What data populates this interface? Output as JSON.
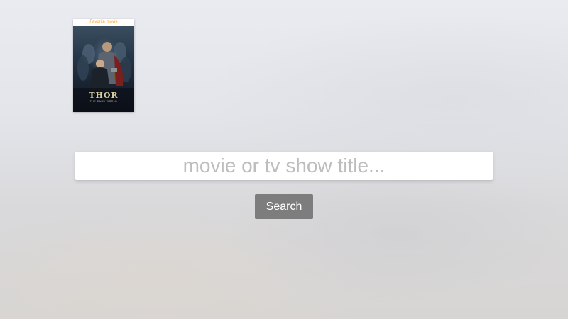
{
  "favorites": {
    "label": "Favorite movie",
    "items": [
      {
        "title": "THOR",
        "subtitle": "THE DARK WORLD"
      }
    ]
  },
  "search": {
    "placeholder": "movie or tv show title...",
    "value": "",
    "button_label": "Search"
  },
  "colors": {
    "label_text": "#f5a623",
    "button_background": "#7d7d7d",
    "field_background": "#ffffff"
  }
}
